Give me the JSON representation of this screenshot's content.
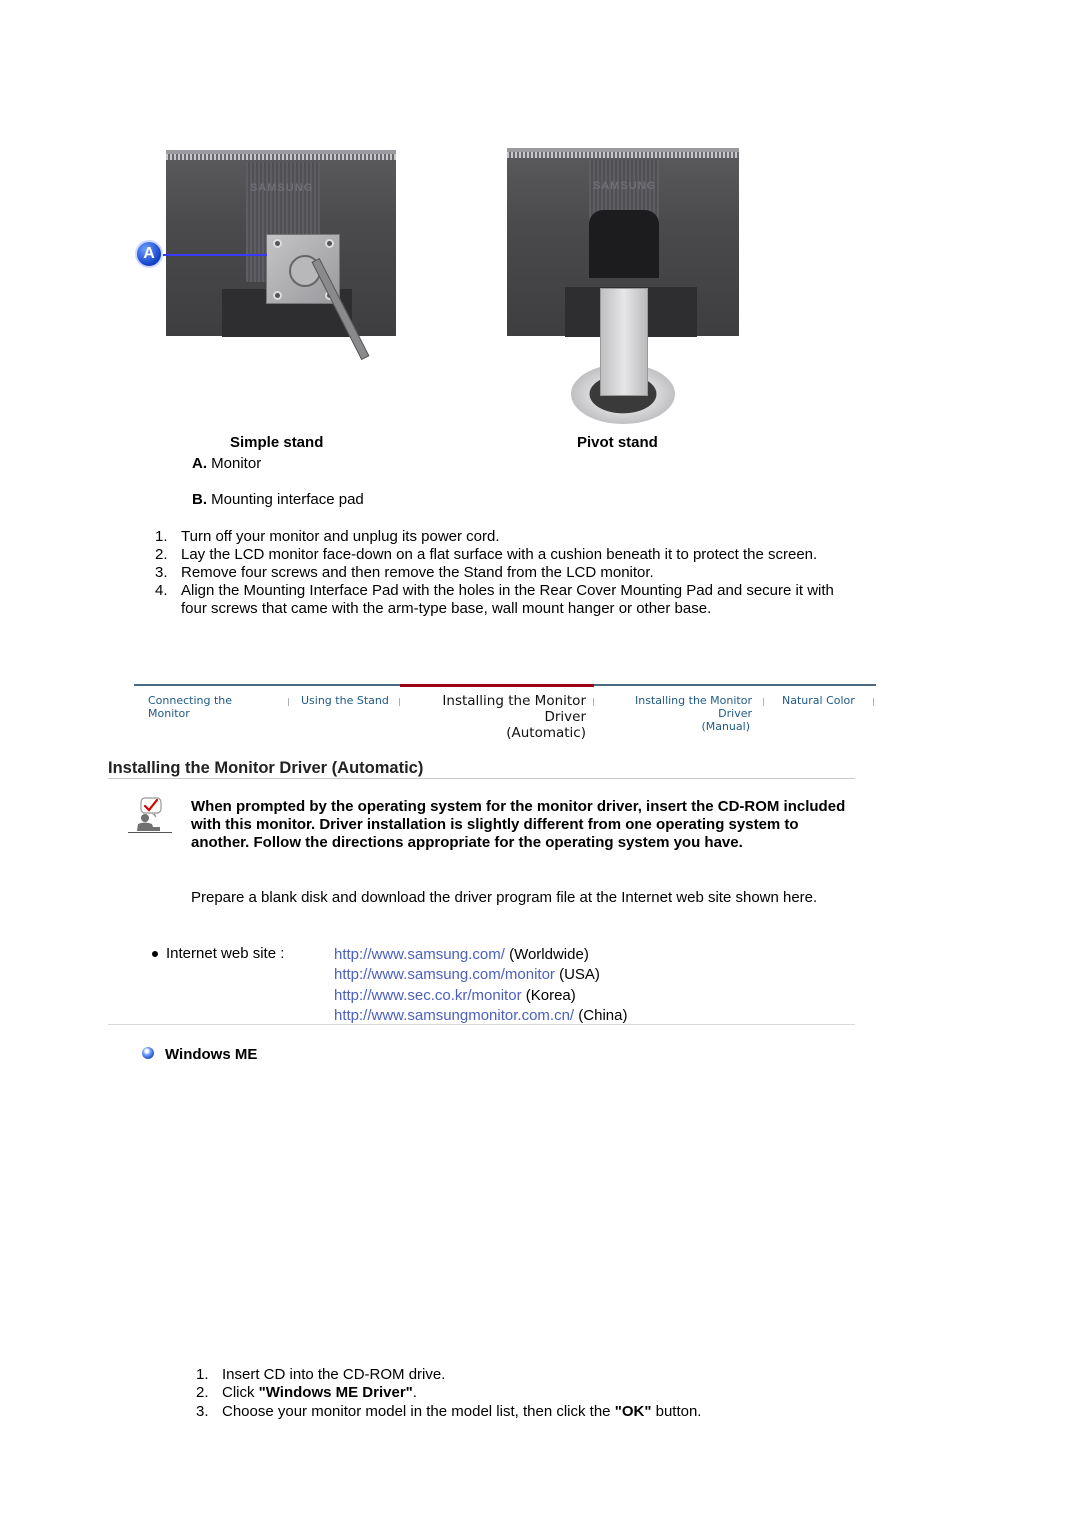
{
  "figures": {
    "simple_stand": {
      "caption": "Simple stand",
      "marker": "A",
      "brand_text": "SAMSUNG"
    },
    "pivot_stand": {
      "caption": "Pivot stand",
      "brand_text": "SAMSUNG"
    }
  },
  "legend": [
    {
      "key": "A.",
      "label": "Monitor"
    },
    {
      "key": "B.",
      "label": "Mounting interface pad"
    }
  ],
  "removal_steps": [
    {
      "num": "1.",
      "text": "Turn off your monitor and unplug its power cord."
    },
    {
      "num": "2.",
      "text": "Lay the LCD monitor face-down on a flat surface with a cushion beneath it to protect the screen."
    },
    {
      "num": "3.",
      "text": "Remove four screws and then remove the Stand from the LCD monitor."
    },
    {
      "num": "4.",
      "text": "Align the Mounting Interface Pad with the holes in the Rear Cover Mounting Pad and secure it with four screws that came with the arm-type base, wall mount hanger or other base."
    }
  ],
  "nav": {
    "tabs": [
      {
        "line1": "Connecting  the Monitor",
        "line2": "",
        "active": false
      },
      {
        "line1": "Using the Stand",
        "line2": "",
        "active": false
      },
      {
        "line1": "Installing the Monitor Driver",
        "line2": "(Automatic)",
        "active": true
      },
      {
        "line1": "Installing the Monitor Driver",
        "line2": "(Manual)",
        "active": false
      },
      {
        "line1": "Natural Color",
        "line2": "",
        "active": false
      }
    ],
    "colors": {
      "active_bar": "#9b0014",
      "inactive_bar": "#4c6a82",
      "tab_text": "#1f5a86"
    }
  },
  "section": {
    "title": "Installing the Monitor Driver (Automatic)",
    "note_bold": "When prompted by the operating system for the monitor driver, insert the CD-ROM included with this monitor. Driver installation is slightly different from one operating system to another. Follow the directions appropriate for the operating system you have.",
    "note_plain": "Prepare a blank disk and download the driver program file at the Internet web site shown here.",
    "websites": {
      "label": "Internet web site :",
      "links": [
        {
          "url": "http://www.samsung.com/",
          "region": "(Worldwide)"
        },
        {
          "url": "http://www.samsung.com/monitor",
          "region": "(USA)"
        },
        {
          "url": "http://www.sec.co.kr/monitor",
          "region": "(Korea)"
        },
        {
          "url": "http://www.samsungmonitor.com.cn/",
          "region": "(China)"
        }
      ],
      "link_color": "#4b5fc0"
    }
  },
  "windows_me": {
    "heading": "Windows ME",
    "steps": [
      {
        "num": "1.",
        "pre": "Insert CD into the CD-ROM drive.",
        "bold": "",
        "post": ""
      },
      {
        "num": "2.",
        "pre": "Click ",
        "bold": "\"Windows ME Driver\"",
        "post": "."
      },
      {
        "num": "3.",
        "pre": "Choose your monitor model in the model list, then click the ",
        "bold": "\"OK\"",
        "post": " button."
      }
    ]
  }
}
